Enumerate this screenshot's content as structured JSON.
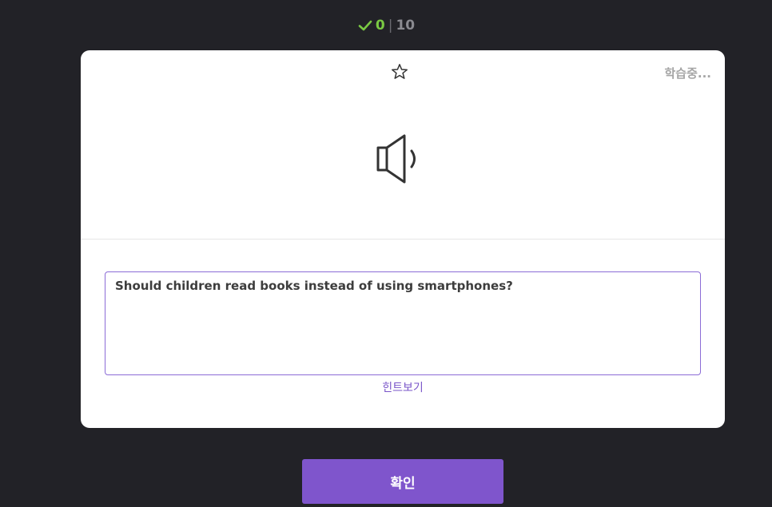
{
  "score": {
    "correct": "0",
    "separator": "|",
    "total": "10"
  },
  "card": {
    "status_label": "학습중...",
    "answer_text": "Should children read books instead of using smartphones?",
    "hint_label": "힌트보기"
  },
  "footer": {
    "confirm_label": "확인"
  },
  "colors": {
    "background": "#222227",
    "accent": "#7f55cc",
    "correct": "#7ac943"
  },
  "icons": {
    "score": "check-icon",
    "favorite": "star-outline-icon",
    "audio": "speaker-icon"
  }
}
